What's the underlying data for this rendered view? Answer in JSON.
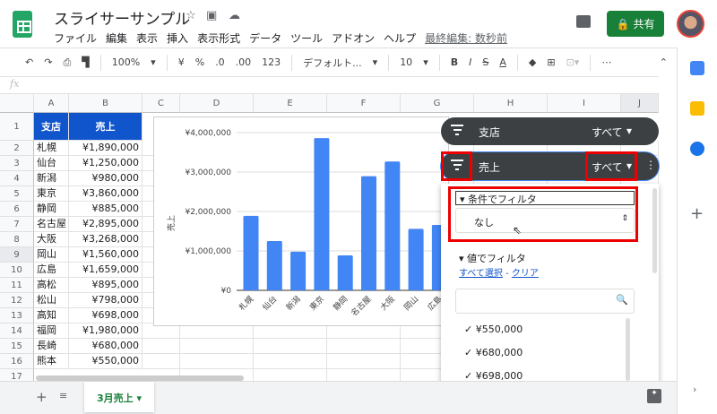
{
  "app": {
    "title": "スライサーサンプル",
    "menu": [
      "ファイル",
      "編集",
      "表示",
      "挿入",
      "表示形式",
      "データ",
      "ツール",
      "アドオン",
      "ヘルプ"
    ],
    "last_edit": "最終編集: 数秒前",
    "share": "共有"
  },
  "toolbar": {
    "zoom": "100%",
    "currency": "¥",
    "percent": "%",
    "dec_less": ".0",
    "dec_more": ".00",
    "format": "123",
    "font": "デフォルト...",
    "size": "10",
    "bold": "B",
    "italic": "I",
    "strike": "S",
    "color": "A",
    "more": "⋯"
  },
  "formula": {
    "fx": "fx",
    "value": ""
  },
  "columns": [
    "A",
    "B",
    "C",
    "D",
    "E",
    "F",
    "G",
    "H",
    "I",
    "J"
  ],
  "table": {
    "headers": [
      "支店",
      "売上"
    ],
    "rows": [
      [
        "札幌",
        "¥1,890,000"
      ],
      [
        "仙台",
        "¥1,250,000"
      ],
      [
        "新潟",
        "¥980,000"
      ],
      [
        "東京",
        "¥3,860,000"
      ],
      [
        "静岡",
        "¥885,000"
      ],
      [
        "名古屋",
        "¥2,895,000"
      ],
      [
        "大阪",
        "¥3,268,000"
      ],
      [
        "岡山",
        "¥1,560,000"
      ],
      [
        "広島",
        "¥1,659,000"
      ],
      [
        "高松",
        "¥895,000"
      ],
      [
        "松山",
        "¥798,000"
      ],
      [
        "高知",
        "¥698,000"
      ],
      [
        "福岡",
        "¥1,980,000"
      ],
      [
        "長崎",
        "¥680,000"
      ],
      [
        "熊本",
        "¥550,000"
      ]
    ]
  },
  "chart_data": {
    "type": "bar",
    "ylabel": "売上",
    "ylim": [
      0,
      4000000
    ],
    "yticks": [
      "¥0",
      "¥1,000,000",
      "¥2,000,000",
      "¥3,000,000",
      "¥4,000,000"
    ],
    "categories": [
      "札幌",
      "仙台",
      "新潟",
      "東京",
      "静岡",
      "名古屋",
      "大阪",
      "岡山",
      "広島"
    ],
    "values": [
      1890000,
      1250000,
      980000,
      3860000,
      885000,
      2895000,
      3268000,
      1560000,
      1659000
    ],
    "color": "#4285f4",
    "grid": true
  },
  "slicers": [
    {
      "label": "支店",
      "value": "すべて"
    },
    {
      "label": "売上",
      "value": "すべて"
    }
  ],
  "filter_panel": {
    "condition_title": "条件でフィルタ",
    "condition_value": "なし",
    "values_title": "値でフィルタ",
    "select_all": "すべて選択",
    "clear": "クリア",
    "values": [
      "¥550,000",
      "¥680,000",
      "¥698,000"
    ]
  },
  "sheet": {
    "tab": "3月売上"
  }
}
